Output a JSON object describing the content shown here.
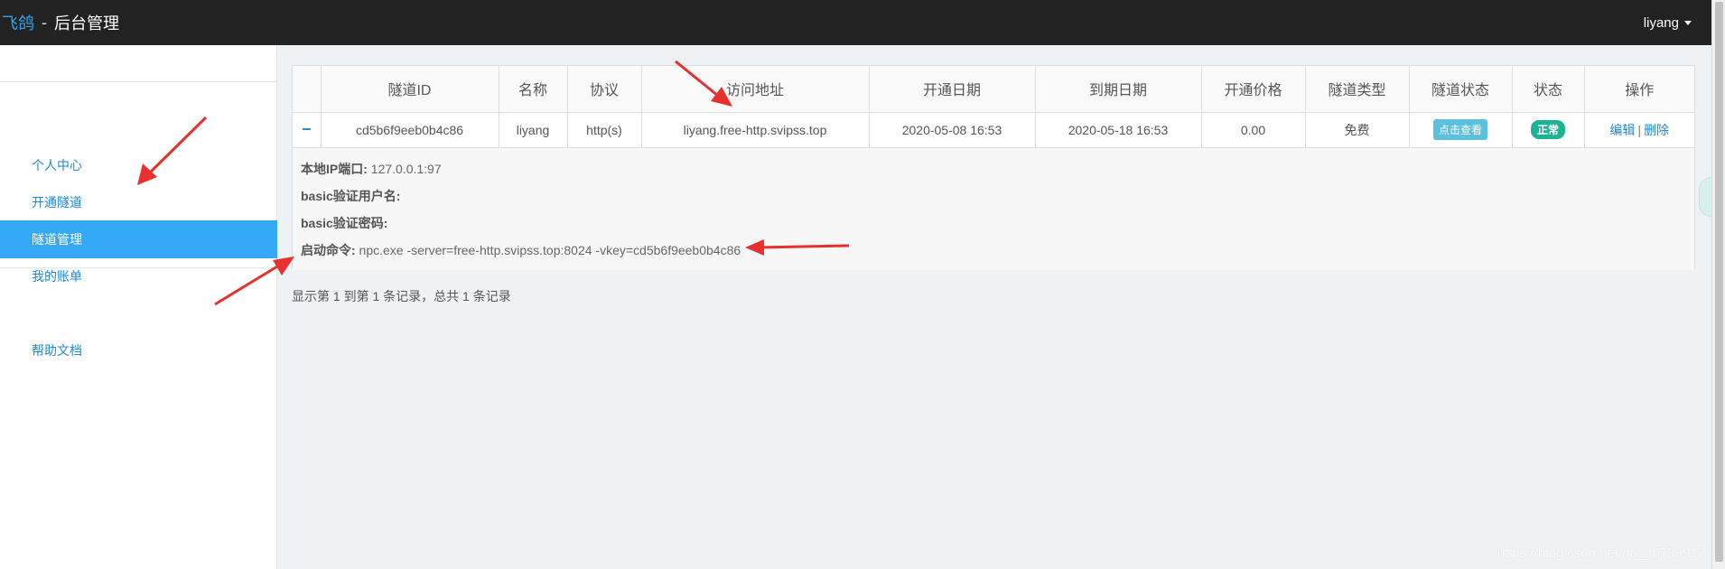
{
  "navbar": {
    "brand_name": "飞鸽",
    "separator": "-",
    "title": "后台管理",
    "username": "liyang"
  },
  "sidebar": {
    "items": [
      {
        "label": "个人中心",
        "active": false
      },
      {
        "label": "开通隧道",
        "active": false
      },
      {
        "label": "隧道管理",
        "active": true
      },
      {
        "label": "我的账单",
        "active": false
      },
      {
        "label": "帮助文档",
        "active": false
      }
    ]
  },
  "table": {
    "columns": [
      "",
      "隧道ID",
      "名称",
      "协议",
      "访问地址",
      "开通日期",
      "到期日期",
      "开通价格",
      "隧道类型",
      "隧道状态",
      "状态",
      "操作"
    ],
    "rows": [
      {
        "expand_icon": "−",
        "id": "cd5b6f9eeb0b4c86",
        "name": "liyang",
        "protocol": "http(s)",
        "address": "liyang.free-http.svipss.top",
        "open_date": "2020-05-08 16:53",
        "expire_date": "2020-05-18 16:53",
        "price": "0.00",
        "type": "免费",
        "tunnel_status_button": "点击查看",
        "status": "正常",
        "action_edit": "编辑",
        "action_sep": "|",
        "action_delete": "删除"
      }
    ],
    "details": {
      "local_ip_label": "本地IP端口:",
      "local_ip_value": " 127.0.0.1:97",
      "basic_user_label": "basic验证用户名:",
      "basic_user_value": "",
      "basic_pass_label": "basic验证密码:",
      "basic_pass_value": "",
      "cmd_label": "启动命令:",
      "cmd_value": " npc.exe -server=free-http.svipss.top:8024 -vkey=cd5b6f9eeb0b4c86"
    }
  },
  "pagination": {
    "summary": "显示第 1 到第 1 条记录，总共 1 条记录"
  },
  "watermark": "https://blog.csdn.net/qq_40739917",
  "colors": {
    "navbar_bg": "#222222",
    "brand_blue": "#33a4f0",
    "sidebar_active": "#35a9f6",
    "link_blue": "#1e88d8",
    "badge_info": "#5bc0de",
    "badge_success": "#1ab394",
    "arrow_red": "#e8312f"
  }
}
